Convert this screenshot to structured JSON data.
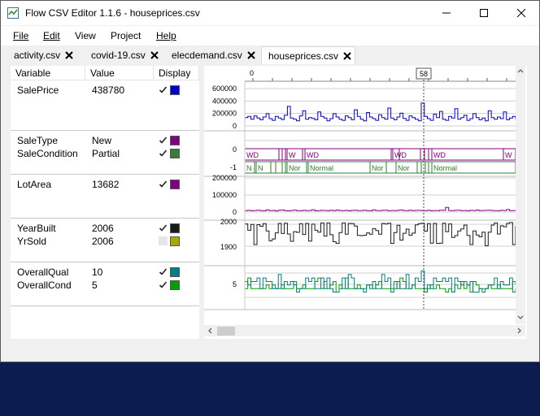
{
  "window": {
    "title": "Flow CSV Editor 1.1.6 - houseprices.csv",
    "controls": [
      "minimize-icon",
      "maximize-icon",
      "close-icon"
    ]
  },
  "menu": [
    {
      "label": "File"
    },
    {
      "label": "Edit"
    },
    {
      "label": "View"
    },
    {
      "label": "Project"
    },
    {
      "label": "Help"
    }
  ],
  "tabs": [
    {
      "label": "activity.csv",
      "active": false
    },
    {
      "label": "covid-19.csv",
      "active": false
    },
    {
      "label": "elecdemand.csv",
      "active": false
    },
    {
      "label": "houseprices.csv",
      "active": true
    }
  ],
  "variables": {
    "headers": {
      "variable": "Variable",
      "value": "Value",
      "display": "Display"
    },
    "groups": [
      {
        "rows": [
          {
            "name": "SalePrice",
            "value": "438780",
            "checked": true,
            "color": "#0000cc"
          }
        ]
      },
      {
        "rows": [
          {
            "name": "SaleType",
            "value": "New",
            "checked": true,
            "color": "#800080"
          },
          {
            "name": "SaleCondition",
            "value": "Partial",
            "checked": true,
            "color": "#3a7a3a"
          }
        ]
      },
      {
        "rows": [
          {
            "name": "LotArea",
            "value": "13682",
            "checked": true,
            "color": "#800080"
          }
        ]
      },
      {
        "rows": [
          {
            "name": "YearBuilt",
            "value": "2006",
            "checked": true,
            "color": "#1a1a1a"
          },
          {
            "name": "YrSold",
            "value": "2006",
            "checked": false,
            "color": "#a8a800"
          }
        ]
      },
      {
        "rows": [
          {
            "name": "OverallQual",
            "value": "10",
            "checked": true,
            "color": "#008080"
          },
          {
            "name": "OverallCond",
            "value": "5",
            "checked": true,
            "color": "#00a000"
          }
        ]
      }
    ]
  },
  "chart_data": {
    "type": "line",
    "x_axis": {
      "start_label": "0",
      "cursor_label": "58"
    },
    "panels": [
      {
        "name": "SalePrice",
        "y_ticks": [
          "600000",
          "400000",
          "200000",
          "0"
        ],
        "ylim": [
          0,
          700000
        ],
        "series": [
          {
            "name": "SalePrice",
            "color": "#0000cc",
            "values": [
              180000,
              200000,
              150000,
              210000,
              170000,
              140000,
              190000,
              250000,
              160000,
              130000,
              200000,
              170000,
              145000,
              220000,
              380000,
              170000,
              150000,
              120000,
              210000,
              300000,
              150000,
              180000,
              165000,
              140000,
              280000,
              200000,
              170000,
              120000,
              160000,
              250000,
              190000,
              150000,
              130000,
              210000,
              180000,
              140000,
              320000,
              200000,
              150000,
              120000,
              270000,
              190000,
              160000,
              130000,
              230000,
              180000,
              150000,
              350000,
              170000,
              140000,
              190000,
              260000,
              165000,
              130000,
              210000,
              180000,
              150000,
              120000,
              438780,
              200000,
              160000,
              130000,
              240000,
              180000,
              290000,
              150000,
              130000,
              200000,
              170000,
              340000,
              150000,
              180000,
              220000,
              130000,
              160000,
              250000,
              180000,
              140000,
              170000,
              120000,
              300000,
              180000,
              150000,
              190000,
              160000,
              280000,
              140000,
              170000,
              200000,
              150000
            ]
          }
        ]
      },
      {
        "name": "Sale",
        "y_ticks": [
          "0",
          "-1"
        ],
        "sale_type_labels": [
          "WD",
          "W",
          "WD",
          "WD",
          "WD",
          "W"
        ],
        "sale_condition_labels": [
          "N",
          "N",
          "Nor",
          "Normal",
          "Nor",
          "Nor",
          "Normal"
        ]
      },
      {
        "name": "LotArea",
        "y_ticks": [
          "200000",
          "100000",
          "0"
        ],
        "ylim": [
          0,
          220000
        ],
        "series": [
          {
            "name": "LotArea",
            "color": "#800080",
            "values": [
              9000,
              11000,
              8500,
              10000,
              12000,
              9500,
              8000,
              14000,
              9000,
              10500,
              7500,
              11500,
              13000,
              9000,
              8000,
              10000,
              12500,
              9500,
              8500,
              11000,
              9000,
              10000,
              15000,
              8000,
              9500,
              11000,
              10000,
              8500,
              12000,
              9000,
              13000,
              10000,
              9000,
              11000,
              8000,
              10500,
              12000,
              9000,
              10000,
              11500,
              9500,
              8000,
              14000,
              10000,
              9000,
              11000,
              12000,
              8500,
              10000,
              9000,
              11000,
              13682,
              10000,
              9500,
              12000,
              9000,
              10500,
              11000,
              10000,
              9000,
              11500,
              8500,
              10000,
              9000,
              12000,
              11000,
              30000,
              10000,
              9000,
              11000,
              12000,
              9500,
              10000,
              8000,
              11000,
              10000,
              13000,
              9000,
              10500,
              11000,
              12000,
              10000,
              9000,
              8500,
              11000,
              10000,
              16000,
              9500,
              10000,
              11000
            ]
          }
        ]
      },
      {
        "name": "YearBuilt",
        "y_ticks": [
          "2000",
          "1900"
        ],
        "ylim": [
          1870,
          2012
        ],
        "series": [
          {
            "name": "YearBuilt",
            "color": "#1a1a1a",
            "values": [
              2003,
              1976,
              2001,
              1915,
              2000,
              1993,
              2004,
              1973,
              1931,
              1939,
              1965,
              2005,
              1962,
              2006,
              1960,
              1929,
              1970,
              1967,
              2004,
              1958,
              2005,
              1930,
              2002,
              1976,
              1968,
              2007,
              1951,
              2007,
              1957,
              1927,
              1920,
              1966,
              2007,
              1959,
              2005,
              2004,
              1994,
              1954,
              1953,
              1955,
              1965,
              1959,
              1983,
              1975,
              1959,
              2005,
              2003,
              2006,
              1920,
              1966,
              1997,
              1934,
              1963,
              1981,
              1955,
              1964,
              1999,
              2004,
              2006,
              1972,
              2004,
              1921,
              2005,
              1920,
              1921,
              2006,
              1970,
              2003,
              1945,
              1953,
              1973,
              1982,
              1998,
              1954,
              1915,
              1973,
              1956,
              1948,
              1968,
              1910,
              1968,
              1998,
              2007,
              1960,
              1995,
              1991,
              2005,
              2009,
              1915,
              1994
            ]
          }
        ]
      },
      {
        "name": "OverallQual / OverallCond",
        "y_ticks": [
          "5"
        ],
        "ylim": [
          0,
          11
        ],
        "series": [
          {
            "name": "OverallQual",
            "color": "#008080",
            "values": [
              7,
              6,
              7,
              7,
              8,
              5,
              8,
              7,
              7,
              5,
              5,
              9,
              5,
              7,
              6,
              7,
              6,
              4,
              5,
              5,
              8,
              7,
              8,
              5,
              5,
              8,
              5,
              8,
              5,
              4,
              4,
              5,
              8,
              5,
              9,
              8,
              5,
              5,
              5,
              4,
              6,
              5,
              7,
              5,
              5,
              9,
              7,
              8,
              4,
              5,
              7,
              5,
              5,
              9,
              5,
              6,
              8,
              7,
              10,
              5,
              6,
              5,
              8,
              7,
              7,
              8,
              7,
              8,
              4,
              8,
              7,
              6,
              7,
              6,
              7,
              4,
              4,
              5,
              4,
              5,
              6,
              6,
              8,
              5,
              7,
              6,
              6,
              8,
              4,
              5
            ]
          },
          {
            "name": "OverallCond",
            "color": "#00a000",
            "values": [
              5,
              8,
              5,
              5,
              5,
              5,
              5,
              6,
              5,
              6,
              5,
              5,
              6,
              5,
              5,
              5,
              7,
              5,
              5,
              6,
              5,
              5,
              5,
              7,
              8,
              5,
              7,
              5,
              6,
              7,
              4,
              6,
              5,
              8,
              5,
              5,
              5,
              6,
              5,
              5,
              6,
              6,
              5,
              6,
              7,
              5,
              5,
              5,
              5,
              7,
              5,
              8,
              7,
              5,
              5,
              6,
              5,
              5,
              5,
              4,
              5,
              6,
              5,
              6,
              5,
              5,
              4,
              5,
              4,
              6,
              5,
              7,
              5,
              6,
              4,
              7,
              6,
              5,
              5,
              5,
              6,
              5,
              5,
              6,
              5,
              5,
              5,
              5,
              7,
              6
            ]
          }
        ]
      }
    ]
  }
}
